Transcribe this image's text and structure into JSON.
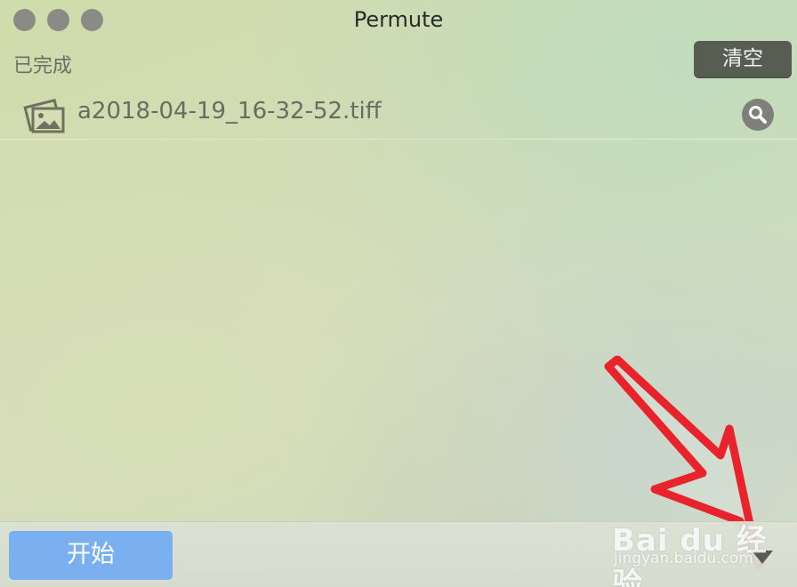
{
  "window": {
    "title": "Permute"
  },
  "completed_section": {
    "label": "已完成",
    "clear_label": "清空"
  },
  "files": [
    {
      "name": "a2018-04-19_16-32-52.tiff",
      "icon": "image-file-icon"
    }
  ],
  "footer": {
    "start_label": "开始"
  },
  "watermark": {
    "brand": "Bai du 经验",
    "url": "jingyan.baidu.com"
  },
  "colors": {
    "start_button": "#7ab0ef",
    "clear_button": "#585d52",
    "annotation_arrow": "#e8232b"
  }
}
